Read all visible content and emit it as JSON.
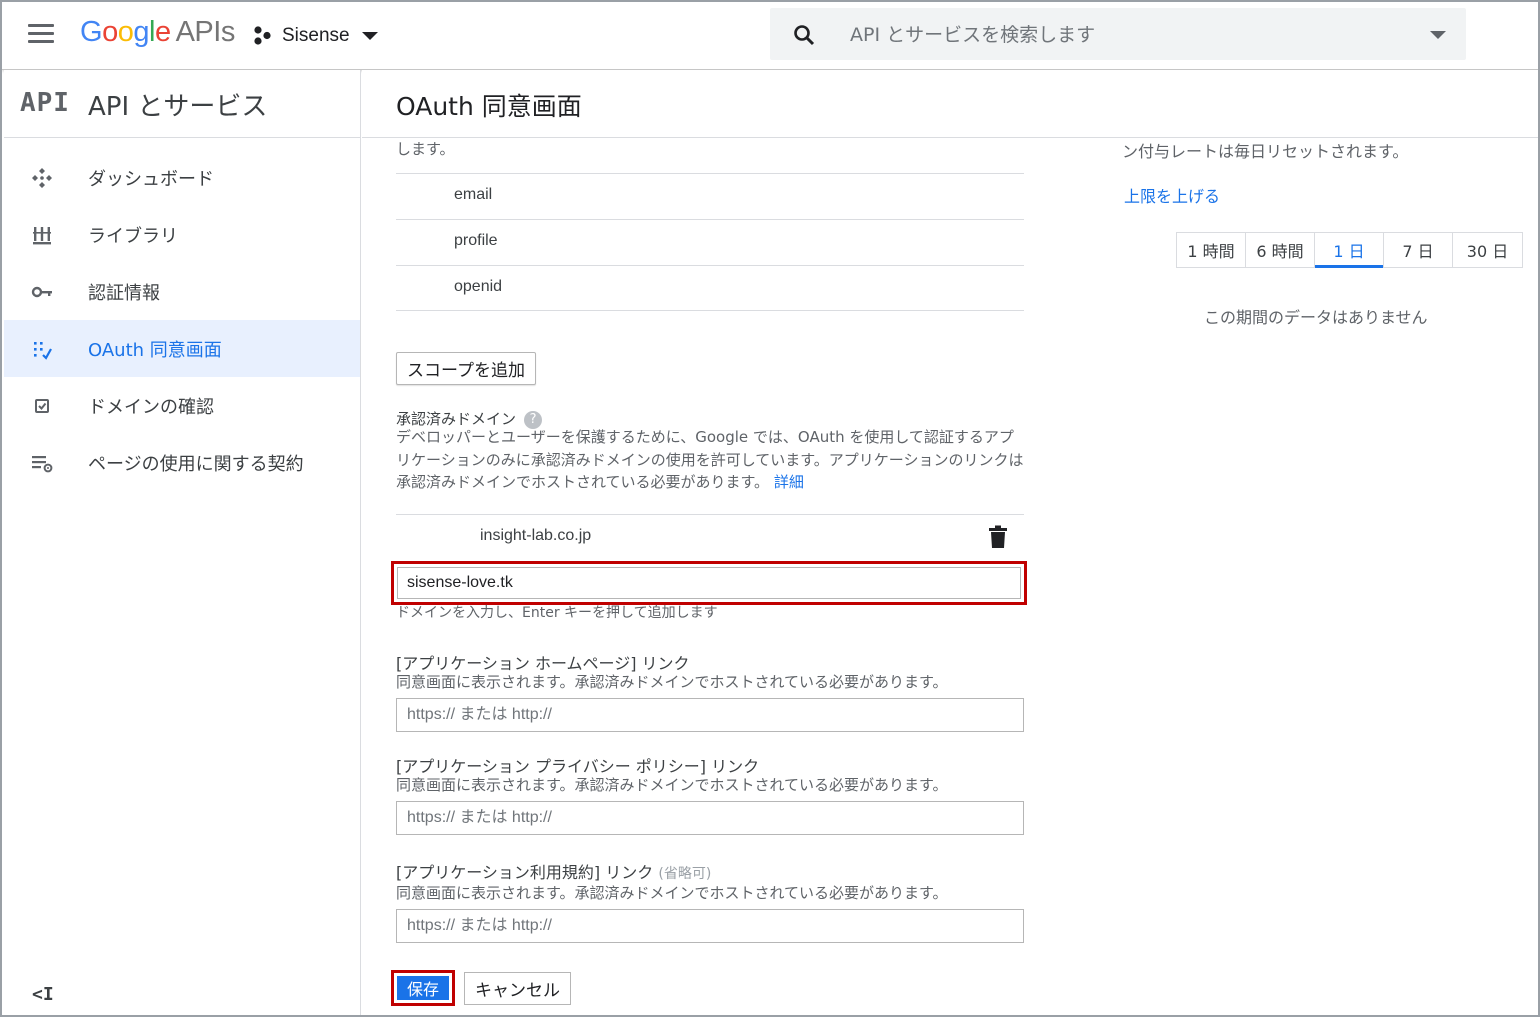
{
  "colors": {
    "accent": "#1a73e8",
    "highlight_border": "#c00000",
    "active_nav_bg": "#e8f0fe"
  },
  "topbar": {
    "logo": {
      "g1": "G",
      "o1": "o",
      "o2": "o",
      "g2": "g",
      "l": "l",
      "e": "e",
      "apis": "APIs"
    },
    "project_name": "Sisense",
    "search_placeholder": "API とサービスを検索します",
    "icons": {
      "menu": "hamburger-icon",
      "search": "search-icon",
      "project": "project-dots-icon"
    }
  },
  "sidebar": {
    "logo_text": "API",
    "title": "API とサービス",
    "items": [
      {
        "label": "ダッシュボード",
        "icon": "dashboard-icon",
        "active": false
      },
      {
        "label": "ライブラリ",
        "icon": "library-icon",
        "active": false
      },
      {
        "label": "認証情報",
        "icon": "key-icon",
        "active": false
      },
      {
        "label": "OAuth 同意画面",
        "icon": "consent-screen-icon",
        "active": true
      },
      {
        "label": "ドメインの確認",
        "icon": "checkbox-icon",
        "active": false
      },
      {
        "label": "ページの使用に関する契約",
        "icon": "settings-list-icon",
        "active": false
      }
    ],
    "collapse_label": "<I"
  },
  "main": {
    "title": "OAuth 同意画面",
    "cut_text": "します。",
    "scopes": [
      "email",
      "profile",
      "openid"
    ],
    "add_scope_button": "スコープを追加",
    "authorized_domains": {
      "label": "承認済みドメイン",
      "help": "?",
      "description": "デベロッパーとユーザーを保護するために、Google では、OAuth を使用して認証するアプリケーションのみに承認済みドメインの使用を許可しています。アプリケーションのリンクは承認済みドメインでホストされている必要があります。",
      "details_link": "詳細",
      "existing": "insight-lab.co.jp",
      "input_value": "sisense-love.tk",
      "hint": "ドメインを入力し、Enter キーを押して追加します"
    },
    "homepage": {
      "label": "[アプリケーション ホームページ] リンク",
      "desc": "同意画面に表示されます。承認済みドメインでホストされている必要があります。",
      "placeholder": "https:// または http://"
    },
    "privacy": {
      "label": "[アプリケーション プライバシー ポリシー] リンク",
      "desc": "同意画面に表示されます。承認済みドメインでホストされている必要があります。",
      "placeholder": "https:// または http://"
    },
    "tos": {
      "label": "[アプリケーション利用規約] リンク",
      "optional": "(省略可)",
      "desc": "同意画面に表示されます。承認済みドメインでホストされている必要があります。",
      "placeholder": "https:// または http://"
    },
    "save_button": "保存",
    "cancel_button": "キャンセル"
  },
  "right_panel": {
    "quota_text": "ン付与レートは毎日リセットされます。",
    "raise_link": "上限を上げる",
    "ranges": [
      {
        "label": "1 時間",
        "active": false
      },
      {
        "label": "6 時間",
        "active": false
      },
      {
        "label": "1 日",
        "active": true
      },
      {
        "label": "7 日",
        "active": false
      },
      {
        "label": "30 日",
        "active": false
      }
    ],
    "no_data": "この期間のデータはありません"
  }
}
